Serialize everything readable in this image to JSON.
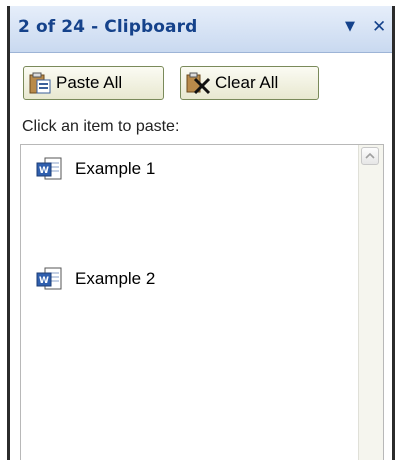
{
  "pane": {
    "title": "2 of 24 - Clipboard",
    "icons": {
      "dropdown": "dropdown-arrow-icon",
      "close": "close-icon"
    },
    "colors": {
      "title": "#15428b",
      "header_bg": "#c9d9f0",
      "border": "#2b2b2b"
    }
  },
  "toolbar": {
    "paste_all_label": "Paste All",
    "clear_all_label": "Clear All",
    "paste_icon": "paste-clipboard-icon",
    "clear_icon": "clear-clipboard-icon"
  },
  "hint": "Click an item to paste:",
  "items": [
    {
      "label": "Example 1",
      "icon": "word-document-icon"
    },
    {
      "label": "Example 2",
      "icon": "word-document-icon"
    }
  ],
  "scrollbar": {
    "up_icon": "scroll-up-icon"
  }
}
